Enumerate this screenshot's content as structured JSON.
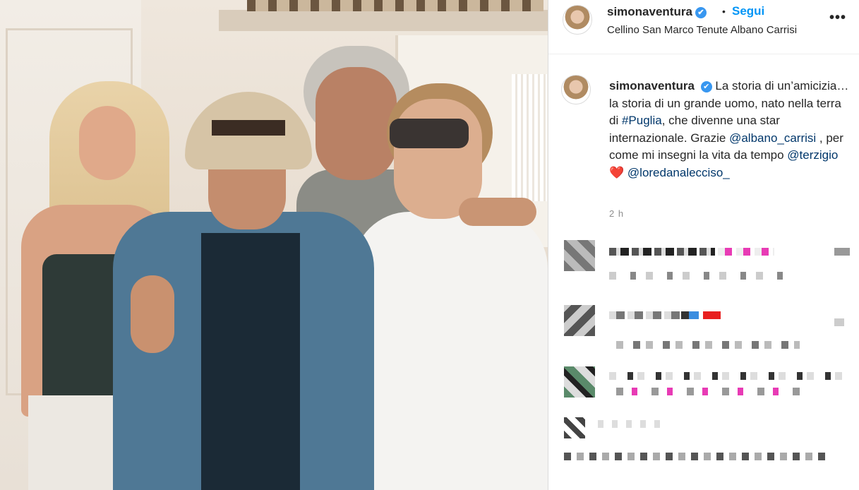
{
  "post": {
    "username": "simonaventura",
    "verified_icon": "✔",
    "separator": "•",
    "follow_label": "Segui",
    "location": "Cellino San Marco Tenute Albano Carrisi",
    "more_label": "•••",
    "caption": {
      "username": "simonaventura",
      "text_1": "La storia di un’amicizia… la storia di un grande uomo, nato nella terra di ",
      "hashtag": "#Puglia",
      "text_2": ", che divenne una star internazionale. Grazie ",
      "mention_1": "@albano_carrisi",
      "text_3": " , per come mi insegni la vita da tempo ",
      "mention_2": "@terzigio",
      "heart": "❤️",
      "mention_3": "@loredanalecciso_"
    },
    "time_ago": "2 h"
  },
  "colors": {
    "link_blue": "#0095f6",
    "mention_blue": "#00376b",
    "verified_blue": "#3897f0",
    "heart_red": "#e3223b",
    "muted_gray": "#8e8e8e"
  }
}
